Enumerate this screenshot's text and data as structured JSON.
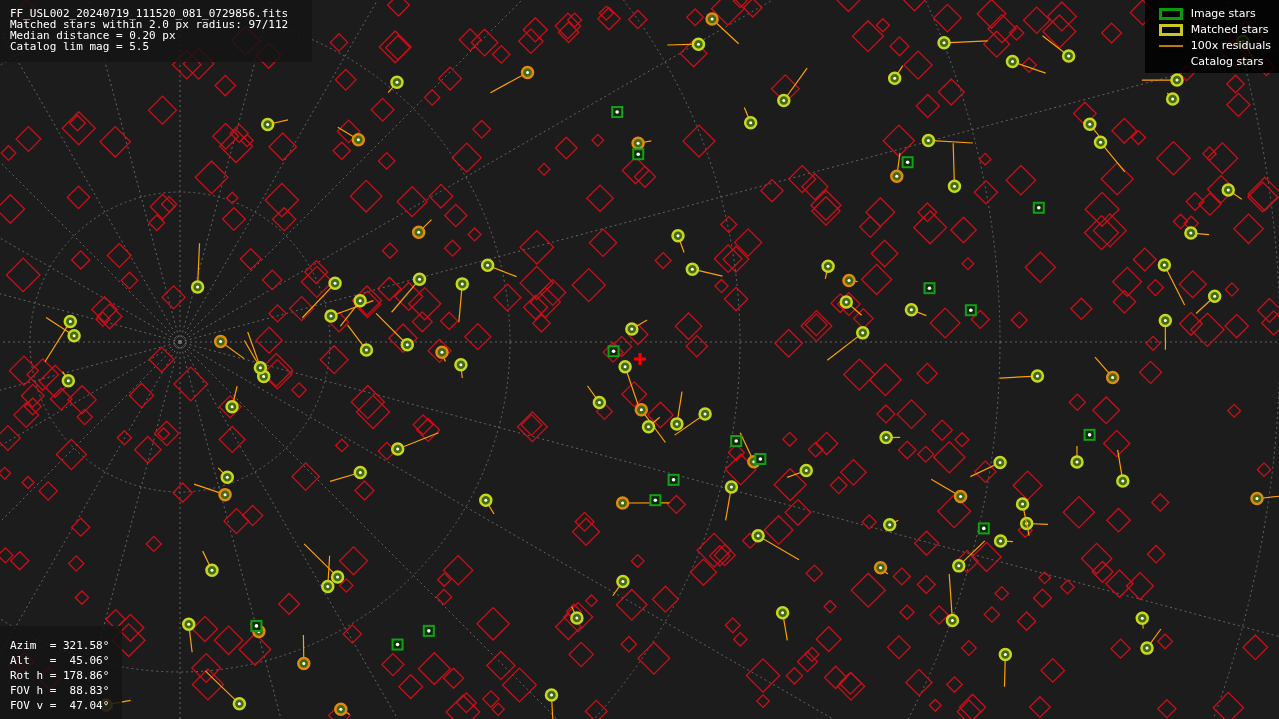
{
  "info": {
    "lines": [
      "FF_USL002_20240719_111520_081_0729856.fits",
      "Matched stars within 2.0 px radius: 97/112",
      "Median distance = 0.20 px",
      "Catalog lim mag = 5.5"
    ]
  },
  "legend": [
    {
      "kind": "image",
      "label": "Image stars"
    },
    {
      "kind": "matched",
      "label": "Matched stars"
    },
    {
      "kind": "residual",
      "label": "100x residuals"
    },
    {
      "kind": "catalog",
      "label": "Catalog stars"
    }
  ],
  "pointing": {
    "lines": [
      "Azim  = 321.58°",
      "Alt   =  45.06°",
      "Rot h = 178.86°",
      "FOV h =  88.83°",
      "FOV v =  47.04°"
    ]
  }
}
